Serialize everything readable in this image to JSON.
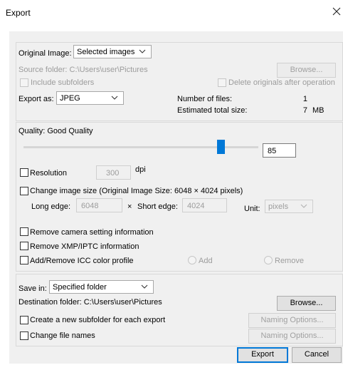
{
  "window": {
    "title": "Export"
  },
  "original": {
    "label": "Original Image:",
    "selected": "Selected images",
    "source_folder": "Source folder: C:\\Users\\user\\Pictures",
    "browse_label": "Browse...",
    "include_subfolders": "Include subfolders",
    "delete_originals": "Delete originals after operation",
    "export_as_label": "Export as:",
    "export_as_value": "JPEG",
    "num_files_label": "Number of files:",
    "num_files_value": "1",
    "est_size_label": "Estimated total size:",
    "est_size_value": "7",
    "est_size_unit": "MB"
  },
  "quality": {
    "label": "Quality: Good Quality",
    "value": "85",
    "slider_percent": 85,
    "resolution_label": "Resolution",
    "resolution_value": "300",
    "resolution_unit": "dpi",
    "change_size_label": "Change image size (Original Image Size: 6048 × 4024 pixels)",
    "long_edge_label": "Long edge:",
    "long_edge_value": "6048",
    "times_sign": "×",
    "short_edge_label": "Short edge:",
    "short_edge_value": "4024",
    "unit_label": "Unit:",
    "unit_value": "pixels",
    "remove_camera": "Remove camera setting information",
    "remove_xmp": "Remove XMP/IPTC information",
    "icc_label": "Add/Remove ICC color profile",
    "icc_add": "Add",
    "icc_remove": "Remove"
  },
  "save": {
    "save_in_label": "Save in:",
    "save_in_value": "Specified folder",
    "destination": "Destination folder: C:\\Users\\user\\Pictures",
    "browse_label": "Browse...",
    "new_subfolder": "Create a new subfolder for each export",
    "naming_options": "Naming Options...",
    "change_names": "Change file names",
    "naming_options2": "Naming Options..."
  },
  "footer": {
    "export_label": "Export",
    "cancel_label": "Cancel"
  },
  "colors": {
    "accent": "#0078d7",
    "panel": "#f0f0f0"
  }
}
